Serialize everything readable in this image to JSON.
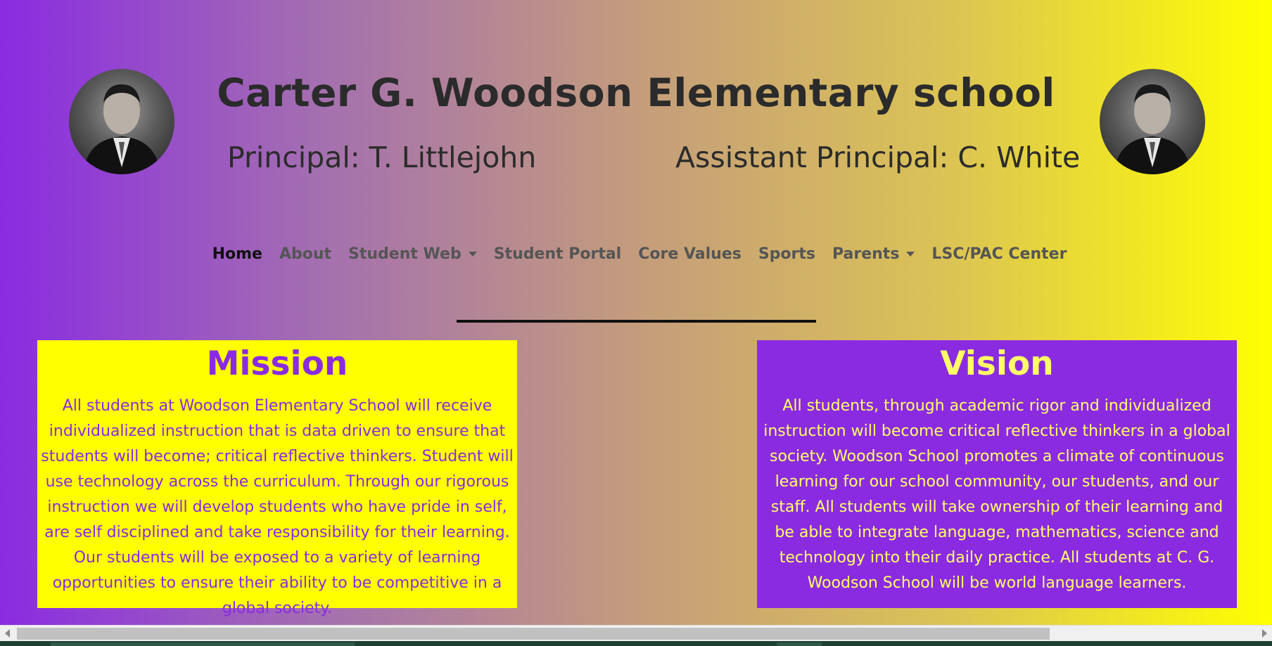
{
  "header": {
    "title": "Carter G. Woodson Elementary school",
    "principal": "Principal: T. Littlejohn",
    "assistant_principal": "Assistant Principal: C. White"
  },
  "nav": {
    "items": [
      {
        "label": "Home",
        "active": true,
        "dropdown": false
      },
      {
        "label": "About",
        "active": false,
        "dropdown": false
      },
      {
        "label": "Student Web",
        "active": false,
        "dropdown": true
      },
      {
        "label": "Student Portal",
        "active": false,
        "dropdown": false
      },
      {
        "label": "Core Values",
        "active": false,
        "dropdown": false
      },
      {
        "label": "Sports",
        "active": false,
        "dropdown": false
      },
      {
        "label": "Parents",
        "active": false,
        "dropdown": true
      },
      {
        "label": "LSC/PAC Center",
        "active": false,
        "dropdown": false
      }
    ]
  },
  "mission": {
    "heading": "Mission",
    "text": "All students at Woodson Elementary School will receive individualized instruction that is data driven to ensure that students will become; critical reflective thinkers. Student will use technology across the curriculum. Through our rigorous instruction we will develop students who have pride in self, are self disciplined and take responsibility for their learning. Our students will be exposed to a variety of learning opportunities to ensure their ability to be competitive in a global society."
  },
  "vision": {
    "heading": "Vision",
    "text": "All students, through academic rigor and individualized instruction will become critical reflective thinkers in a global society. Woodson School promotes a climate of continuous learning for our school community, our students, and our staff. All students will take ownership of their learning and be able to integrate language, mathematics, science and technology into their daily practice. All students at C. G. Woodson School will be world language learners."
  },
  "colors": {
    "purple": "#8a2be2",
    "yellow": "#ffff00"
  }
}
